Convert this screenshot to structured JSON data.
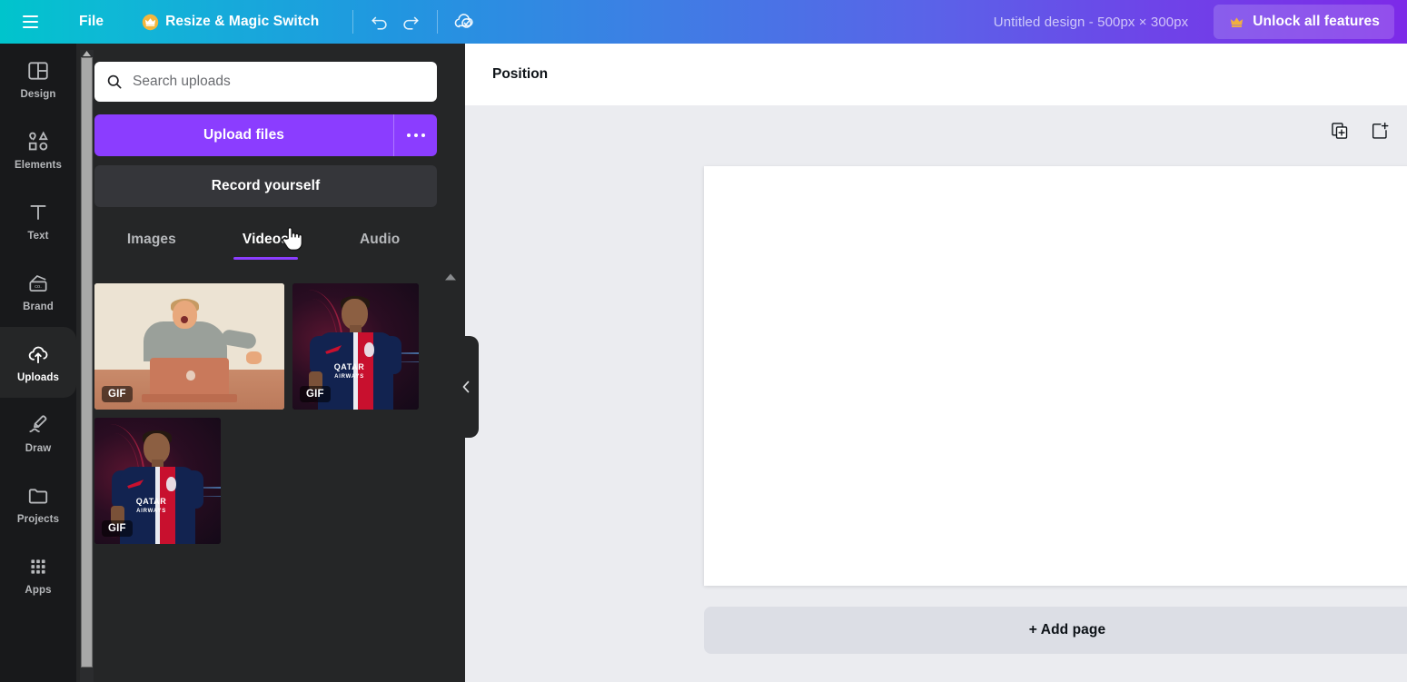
{
  "topbar": {
    "menu_icon": "hamburger-menu-icon",
    "file_label": "File",
    "resize_label": "Resize & Magic Switch",
    "resize_icon": "crown-icon",
    "undo_icon": "undo-icon",
    "redo_icon": "redo-icon",
    "save_status_icon": "cloud-check-icon",
    "design_title": "Untitled design - 500px × 300px",
    "unlock_label": "Unlock all features",
    "unlock_icon": "crown-icon",
    "gradient_start": "#00C4CC",
    "gradient_mid": "#3D7FE4",
    "gradient_end": "#7D2AE8"
  },
  "rail": {
    "items": [
      {
        "label": "Design",
        "icon": "layout-icon",
        "active": false
      },
      {
        "label": "Elements",
        "icon": "shapes-icon",
        "active": false
      },
      {
        "label": "Text",
        "icon": "text-t-icon",
        "active": false
      },
      {
        "label": "Brand",
        "icon": "brand-card-icon",
        "active": false
      },
      {
        "label": "Uploads",
        "icon": "cloud-upload-icon",
        "active": true
      },
      {
        "label": "Draw",
        "icon": "pen-draw-icon",
        "active": false
      },
      {
        "label": "Projects",
        "icon": "folder-icon",
        "active": false
      },
      {
        "label": "Apps",
        "icon": "grid-dots-icon",
        "active": false
      }
    ],
    "active_color": "#FFFFFF",
    "inactive_color": "#B6B8BB"
  },
  "panel": {
    "search": {
      "placeholder": "Search uploads",
      "value": "",
      "icon": "search-icon"
    },
    "upload_button": "Upload files",
    "more_button_icon": "ellipsis-icon",
    "record_button": "Record yourself",
    "accent_color": "#8B3DFF",
    "tabs": [
      {
        "label": "Images",
        "active": false
      },
      {
        "label": "Videos",
        "active": true
      },
      {
        "label": "Audio",
        "active": false
      }
    ],
    "thumbnails": [
      {
        "badge": "GIF",
        "alt": "person laughing at laptop",
        "kind": "laptop"
      },
      {
        "badge": "GIF",
        "alt": "PSG football player portrait",
        "kind": "psg"
      },
      {
        "badge": "GIF",
        "alt": "PSG football player portrait",
        "kind": "psg"
      }
    ],
    "jersey_sponsor": "QATAR",
    "jersey_sponsor_sub": "AIRWAYS",
    "collapse_icon": "chevron-left-icon",
    "scroll_up_icon": "caret-up-icon"
  },
  "editor": {
    "toolbar": {
      "position_label": "Position"
    },
    "page_actions": [
      {
        "label": "Duplicate page",
        "icon": "duplicate-page-icon"
      },
      {
        "label": "Add page",
        "icon": "add-page-icon"
      }
    ],
    "add_page_label": "+ Add page",
    "canvas_background": "#FFFFFF",
    "workspace_background": "#EBECF0"
  },
  "cursor": {
    "icon": "pointing-hand-cursor"
  }
}
